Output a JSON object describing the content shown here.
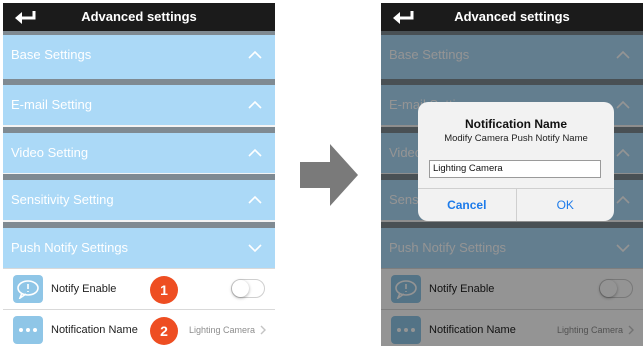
{
  "colors": {
    "topbar": "#1b1b1b",
    "section_bg": "#abd9f7",
    "badge": "#ee4e22",
    "dialog_button": "#1d7bea"
  },
  "left_screen": {
    "title": "Advanced settings",
    "back_icon": "back-arrow-icon",
    "sections": [
      {
        "label": "Base Settings",
        "icon": "chevron-up-icon"
      },
      {
        "label": "E-mail Setting",
        "icon": "chevron-up-icon"
      },
      {
        "label": "Video Setting",
        "icon": "chevron-up-icon"
      },
      {
        "label": "Sensitivity Setting",
        "icon": "chevron-up-icon"
      },
      {
        "label": "Push Notify Settings",
        "icon": "chevron-down-icon"
      }
    ],
    "rows": [
      {
        "label": "Notify Enable",
        "badge": "1",
        "icon": "chat-bubble-icon",
        "toggle_on": false
      },
      {
        "label": "Notification Name",
        "badge": "2",
        "icon": "dots-icon",
        "value": "Lighting Camera"
      }
    ]
  },
  "right_screen": {
    "title": "Advanced settings",
    "sections": [
      {
        "label": "Base Settings"
      },
      {
        "label": "E-mail Setting"
      },
      {
        "label": "Video Setting"
      },
      {
        "label": "Sensitivity Setting"
      },
      {
        "label": "Push Notify Settings"
      }
    ],
    "rows": [
      {
        "label": "Notify Enable"
      },
      {
        "label": "Notification Name",
        "value": "Lighting Camera"
      }
    ],
    "dialog": {
      "title": "Notification Name",
      "subtitle": "Modify Camera Push Notify Name",
      "input_value": "Lighting Camera",
      "cancel_label": "Cancel",
      "ok_label": "OK"
    }
  }
}
